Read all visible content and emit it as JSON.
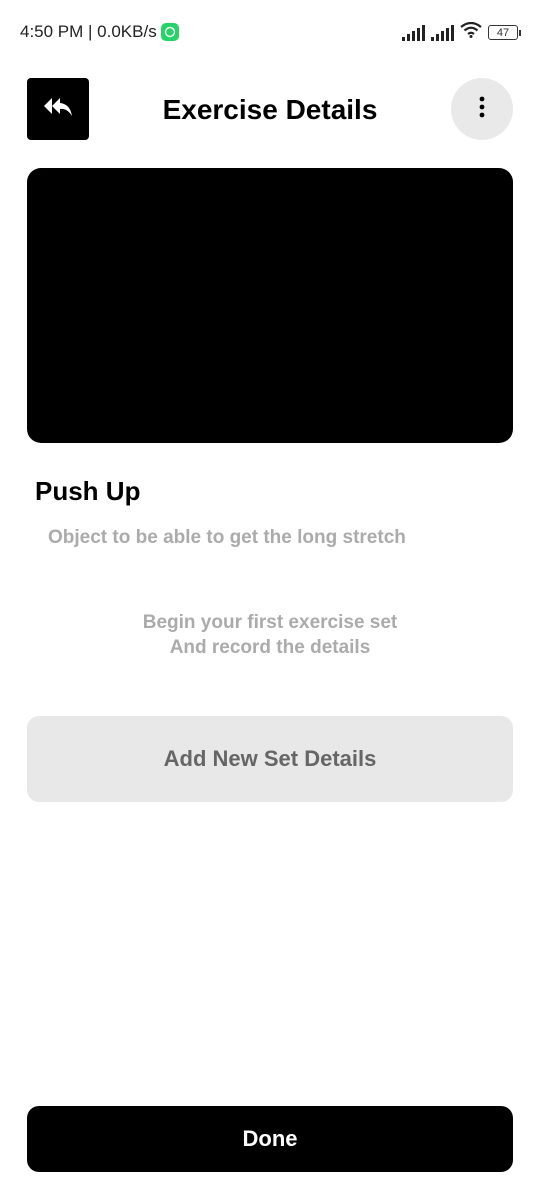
{
  "status_bar": {
    "time_speed": "4:50 PM | 0.0KB/s",
    "battery": "47"
  },
  "header": {
    "title": "Exercise Details"
  },
  "exercise": {
    "name": "Push Up",
    "description": "Object to be able to get the long stretch"
  },
  "empty_state": {
    "line1": "Begin your first exercise set",
    "line2": "And record the details"
  },
  "actions": {
    "add_set_label": "Add New Set Details",
    "done_label": "Done"
  },
  "icons": {
    "back": "double-reply-arrow-icon",
    "menu": "more-vertical-icon",
    "whatsapp": "whatsapp-icon",
    "signal": "signal-icon",
    "wifi": "wifi-icon"
  },
  "colors": {
    "primary": "#000000",
    "muted_text": "#ababab",
    "secondary_button": "#e8e8e8",
    "accent_green": "#25D366"
  }
}
